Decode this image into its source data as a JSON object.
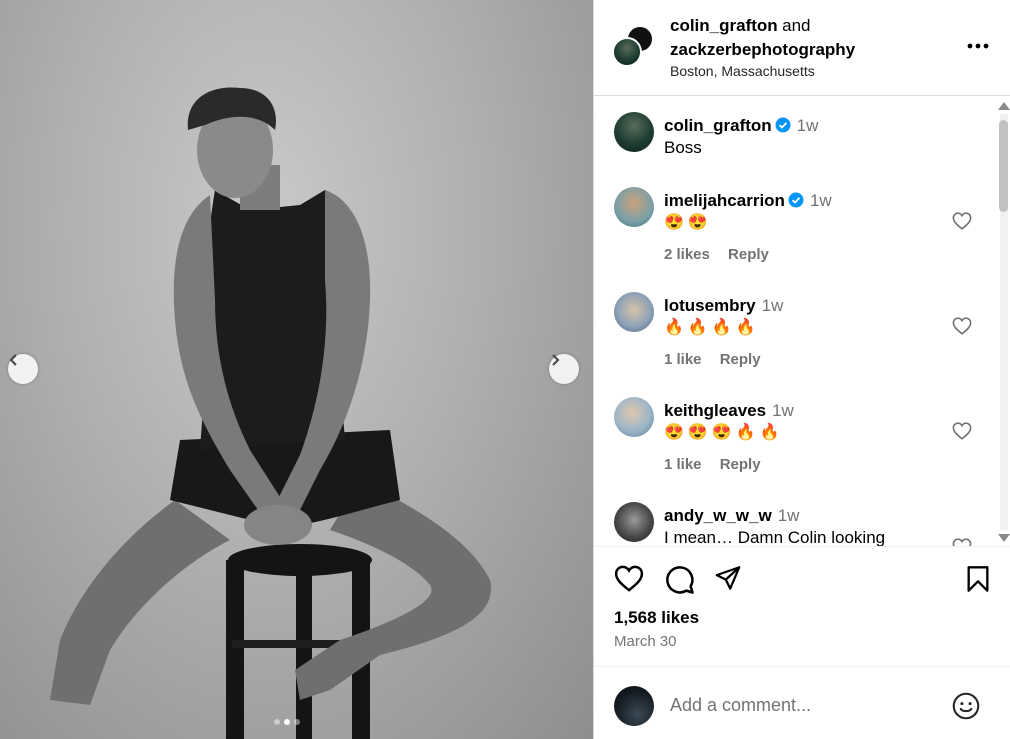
{
  "header": {
    "user1": "colin_grafton",
    "joiner": "and",
    "user2": "zackzerbephotography",
    "location": "Boston, Massachusetts"
  },
  "comments": [
    {
      "username": "colin_grafton",
      "verified": true,
      "time": "1w",
      "text": "Boss",
      "likes": "",
      "reply": ""
    },
    {
      "username": "imelijahcarrion",
      "verified": true,
      "time": "1w",
      "text": "😍😍",
      "likes": "2 likes",
      "reply": "Reply"
    },
    {
      "username": "lotusembry",
      "verified": false,
      "time": "1w",
      "text": "🔥🔥🔥🔥",
      "likes": "1 like",
      "reply": "Reply"
    },
    {
      "username": "keithgleaves",
      "verified": false,
      "time": "1w",
      "text": "😍😍😍🔥🔥",
      "likes": "1 like",
      "reply": "Reply"
    },
    {
      "username": "andy_w_w_w",
      "verified": false,
      "time": "1w",
      "text": "I mean… Damn Colin looking",
      "likes": "",
      "reply": ""
    }
  ],
  "post": {
    "likes": "1,568 likes",
    "date": "March 30"
  },
  "add_comment": {
    "placeholder": "Add a comment..."
  },
  "carousel": {
    "count": 3,
    "active_index": 1
  },
  "colors": {
    "verified": "#0095f6",
    "muted_text": "#737373"
  }
}
